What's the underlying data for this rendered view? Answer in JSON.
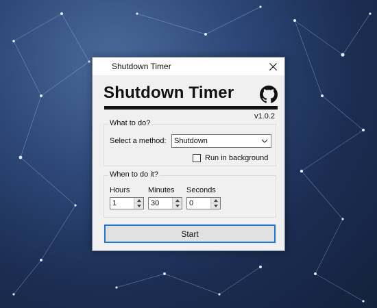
{
  "window": {
    "title": "Shutdown Timer",
    "heading": "Shutdown Timer",
    "version": "v1.0.2"
  },
  "icons": {
    "github": "github-icon",
    "close": "close-icon"
  },
  "what_group": {
    "legend": "What to do?",
    "method_label": "Select a method:",
    "method_value": "Shutdown",
    "run_in_background_label": "Run in background",
    "run_in_background_checked": false
  },
  "when_group": {
    "legend": "When to do it?",
    "hours_label": "Hours",
    "hours_value": "1",
    "minutes_label": "Minutes",
    "minutes_value": "30",
    "seconds_label": "Seconds",
    "seconds_value": "0"
  },
  "start_label": "Start",
  "colors": {
    "accent": "#1976d2",
    "window_bg": "#f0f0f0"
  }
}
